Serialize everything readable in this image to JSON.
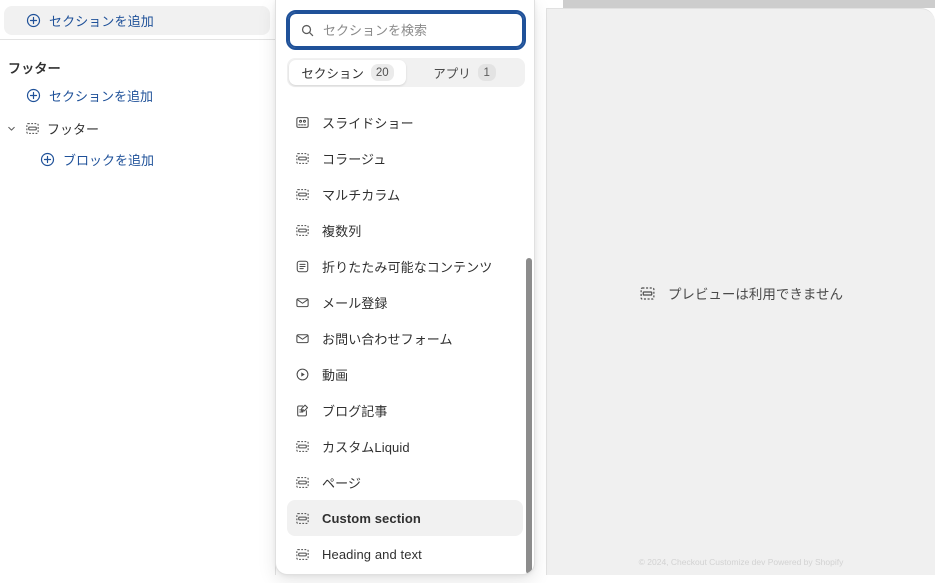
{
  "sidebar": {
    "add_section_top": {
      "label": "セクションを追加",
      "icon": "plus-circle-icon"
    },
    "group_heading": "フッター",
    "add_section_sub": {
      "label": "セクションを追加",
      "icon": "plus-circle-icon"
    },
    "footer_item": {
      "label": "フッター",
      "icon": "section-icon",
      "chevron": "chevron-down-icon"
    },
    "add_block": {
      "label": "ブロックを追加",
      "icon": "plus-circle-icon"
    }
  },
  "preview": {
    "empty_label": "プレビューは利用できません",
    "empty_icon": "section-icon",
    "footnote": "© 2024, Checkout Customize dev Powered by Shopify"
  },
  "popover": {
    "search": {
      "placeholder": "セクションを検索",
      "value": "",
      "icon": "search-icon"
    },
    "tabs": [
      {
        "label": "セクション",
        "count": "20",
        "active": true
      },
      {
        "label": "アプリ",
        "count": "1",
        "active": false
      }
    ],
    "items": [
      {
        "label": "スライドショー",
        "icon": "slideshow-icon",
        "selected": false
      },
      {
        "label": "コラージュ",
        "icon": "section-icon",
        "selected": false
      },
      {
        "label": "マルチカラム",
        "icon": "section-icon",
        "selected": false
      },
      {
        "label": "複数列",
        "icon": "section-icon",
        "selected": false
      },
      {
        "label": "折りたたみ可能なコンテンツ",
        "icon": "collapsible-icon",
        "selected": false
      },
      {
        "label": "メール登録",
        "icon": "mail-icon",
        "selected": false
      },
      {
        "label": "お問い合わせフォーム",
        "icon": "mail-icon",
        "selected": false
      },
      {
        "label": "動画",
        "icon": "play-circle-icon",
        "selected": false
      },
      {
        "label": "ブログ記事",
        "icon": "edit-document-icon",
        "selected": false
      },
      {
        "label": "カスタムLiquid",
        "icon": "section-icon",
        "selected": false
      },
      {
        "label": "ページ",
        "icon": "section-icon",
        "selected": false
      },
      {
        "label": "Custom section",
        "icon": "section-icon",
        "selected": true
      },
      {
        "label": "Heading and text",
        "icon": "section-icon",
        "selected": false
      }
    ]
  },
  "colors": {
    "link_blue": "#1f5199",
    "focus_blue": "#1f5199",
    "selected_bg": "#f1f1f1",
    "text": "#303030",
    "preview_bg": "#f0f0f0"
  }
}
